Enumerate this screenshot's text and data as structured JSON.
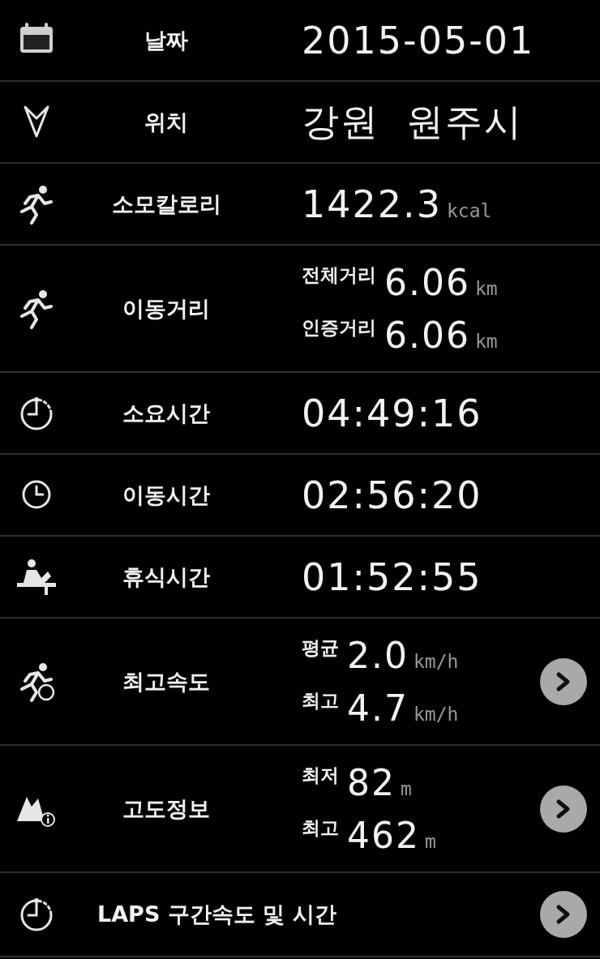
{
  "rows": [
    {
      "kind": "single",
      "label": "날짜",
      "value": "2015-05-01",
      "arrow": false
    },
    {
      "kind": "single",
      "label": "위치",
      "value": "강원  원주시",
      "arrow": false
    },
    {
      "kind": "single",
      "label": "소모칼로리",
      "value": "1422.3",
      "unit": "kcal",
      "arrow": false
    },
    {
      "kind": "pair",
      "label": "이동거리",
      "lines": [
        {
          "label": "전체거리",
          "value": "6.06",
          "unit": "km"
        },
        {
          "label": "인증거리",
          "value": "6.06",
          "unit": "km"
        }
      ],
      "arrow": false
    },
    {
      "kind": "single",
      "label": "소요시간",
      "value": "04:49:16",
      "arrow": false
    },
    {
      "kind": "single",
      "label": "이동시간",
      "value": "02:56:20",
      "arrow": false
    },
    {
      "kind": "single",
      "label": "휴식시간",
      "value": "01:52:55",
      "arrow": false
    },
    {
      "kind": "pair",
      "label": "최고속도",
      "lines": [
        {
          "label": "평균",
          "value": "2.0",
          "unit": "km/h"
        },
        {
          "label": "최고",
          "value": "4.7",
          "unit": "km/h"
        }
      ],
      "arrow": true
    },
    {
      "kind": "pair",
      "label": "고도정보",
      "lines": [
        {
          "label": "최저",
          "value": "82",
          "unit": "m"
        },
        {
          "label": "최고",
          "value": "462",
          "unit": "m"
        }
      ],
      "arrow": true
    },
    {
      "kind": "laps",
      "label": "LAPS 구간속도 및 시간",
      "arrow": true
    }
  ]
}
